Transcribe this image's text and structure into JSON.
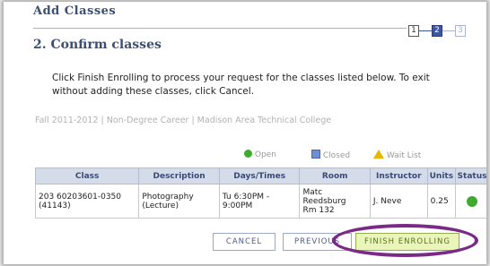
{
  "page": {
    "title": "Add Classes",
    "section_heading": "2.  Confirm classes",
    "instructions": [
      "Click Finish Enrolling to process your request for the classes listed below. To exit",
      "without adding these classes, click Cancel."
    ],
    "term_line": "Fall 2011-2012 | Non-Degree Career | Madison Area Technical College"
  },
  "steps": [
    {
      "label": "1",
      "state": "done"
    },
    {
      "label": "2",
      "state": "current"
    },
    {
      "label": "3",
      "state": "future"
    }
  ],
  "legend": {
    "open": "Open",
    "closed": "Closed",
    "wait_list": "Wait List"
  },
  "table": {
    "headers": [
      "Class",
      "Description",
      "Days/Times",
      "Room",
      "Instructor",
      "Units",
      "Status"
    ],
    "rows": [
      {
        "class_line1": "203 60203601-0350",
        "class_line2": "(41143)",
        "description_line1": "Photography",
        "description_line2": "(Lecture)",
        "days_line1": "Tu 6:30PM -",
        "days_line2": "9:00PM",
        "room_line1": "Matc",
        "room_line2": "Reedsburg",
        "room_line3": "Rm 132",
        "instructor": "J. Neve",
        "units": "0.25",
        "status": "Open"
      }
    ]
  },
  "buttons": {
    "cancel": "CANCEL",
    "previous": "PREVIOUS",
    "finish": "FINISH ENROLLING"
  },
  "colors": {
    "accent": "#3b4f74",
    "open": "#3dab2e",
    "highlight": "#7a2a86"
  }
}
